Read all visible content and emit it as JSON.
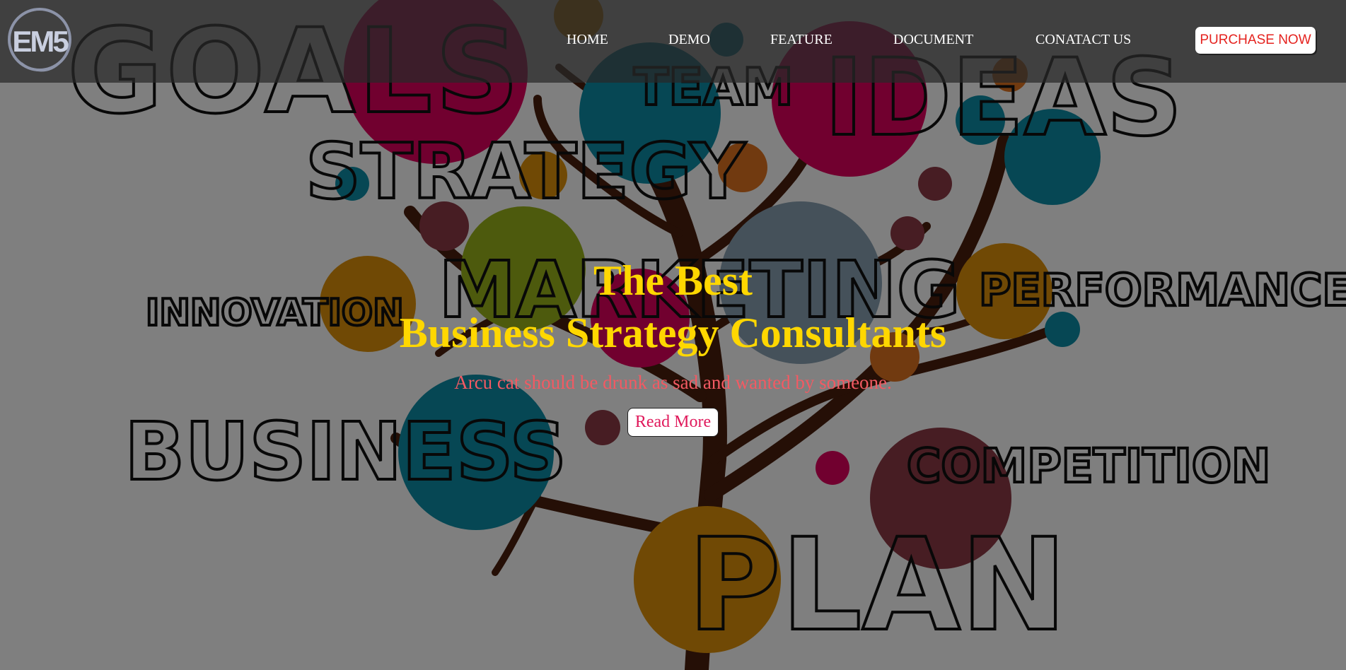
{
  "brand": {
    "logo_text": "EM5"
  },
  "nav": {
    "items": [
      {
        "label": "HOME"
      },
      {
        "label": "DEMO"
      },
      {
        "label": "FEATURE"
      },
      {
        "label": "DOCUMENT"
      },
      {
        "label": "CONATACT US"
      }
    ],
    "purchase_label": "PURCHASE NOW"
  },
  "hero": {
    "title_line1": "The Best",
    "title_line2": "Business Strategy Consultants",
    "subtitle": "Arcu cat should be drunk as sad and wanted by someone.",
    "button_label": "Read More",
    "background_words": {
      "goals": "GOALS",
      "team": "TEAM",
      "ideas": "IDEAS",
      "strategy": "STRATEGY",
      "innovation": "INNOVATION",
      "marketing": "MARKETING",
      "performance": "PERFORMANCE",
      "business": "BUSINESS",
      "competition": "COMPETITION",
      "plan": "PLAN"
    }
  },
  "colors": {
    "title": "#ffd700",
    "subtitle": "#f25a63",
    "purchase_text": "#e5231f",
    "button_text": "#e0195b",
    "header_bg": "#282828"
  }
}
